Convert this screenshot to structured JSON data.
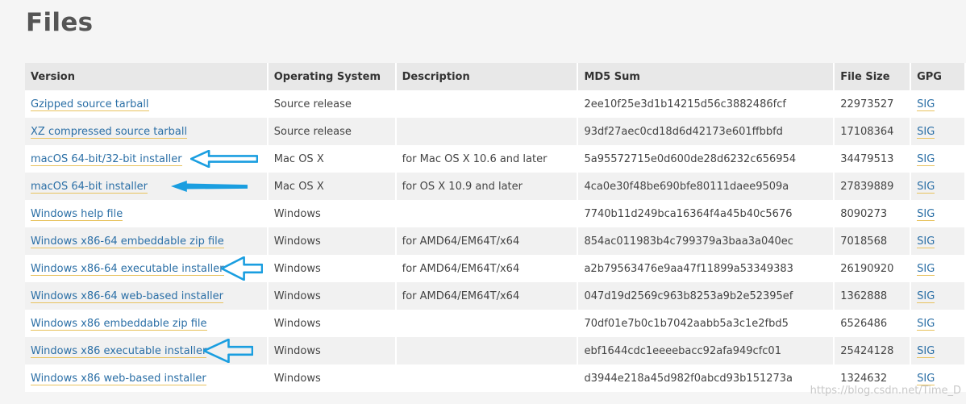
{
  "page": {
    "title": "Files",
    "watermark": "https://blog.csdn.net/Time_D"
  },
  "colors": {
    "link": "#2b6fa6",
    "link_underline": "#e8c25e",
    "arrow": "#1a9ee0"
  },
  "table": {
    "headers": {
      "version": "Version",
      "os": "Operating System",
      "description": "Description",
      "md5": "MD5 Sum",
      "size": "File Size",
      "gpg": "GPG"
    },
    "rows": [
      {
        "version": "Gzipped source tarball",
        "os": "Source release",
        "description": "",
        "md5": "2ee10f25e3d1b14215d56c3882486fcf",
        "size": "22973527",
        "gpg": "SIG"
      },
      {
        "version": "XZ compressed source tarball",
        "os": "Source release",
        "description": "",
        "md5": "93df27aec0cd18d6d42173e601ffbbfd",
        "size": "17108364",
        "gpg": "SIG"
      },
      {
        "version": "macOS 64-bit/32-bit installer",
        "os": "Mac OS X",
        "description": "for Mac OS X 10.6 and later",
        "md5": "5a95572715e0d600de28d6232c656954",
        "size": "34479513",
        "gpg": "SIG"
      },
      {
        "version": "macOS 64-bit installer",
        "os": "Mac OS X",
        "description": "for OS X 10.9 and later",
        "md5": "4ca0e30f48be690bfe80111daee9509a",
        "size": "27839889",
        "gpg": "SIG"
      },
      {
        "version": "Windows help file",
        "os": "Windows",
        "description": "",
        "md5": "7740b11d249bca16364f4a45b40c5676",
        "size": "8090273",
        "gpg": "SIG"
      },
      {
        "version": "Windows x86-64 embeddable zip file",
        "os": "Windows",
        "description": "for AMD64/EM64T/x64",
        "md5": "854ac011983b4c799379a3baa3a040ec",
        "size": "7018568",
        "gpg": "SIG"
      },
      {
        "version": "Windows x86-64 executable installer",
        "os": "Windows",
        "description": "for AMD64/EM64T/x64",
        "md5": "a2b79563476e9aa47f11899a53349383",
        "size": "26190920",
        "gpg": "SIG"
      },
      {
        "version": "Windows x86-64 web-based installer",
        "os": "Windows",
        "description": "for AMD64/EM64T/x64",
        "md5": "047d19d2569c963b8253a9b2e52395ef",
        "size": "1362888",
        "gpg": "SIG"
      },
      {
        "version": "Windows x86 embeddable zip file",
        "os": "Windows",
        "description": "",
        "md5": "70df01e7b0c1b7042aabb5a3c1e2fbd5",
        "size": "6526486",
        "gpg": "SIG"
      },
      {
        "version": "Windows x86 executable installer",
        "os": "Windows",
        "description": "",
        "md5": "ebf1644cdc1eeeebacc92afa949cfc01",
        "size": "25424128",
        "gpg": "SIG"
      },
      {
        "version": "Windows x86 web-based installer",
        "os": "Windows",
        "description": "",
        "md5": "d3944e218a45d982f0abcd93b151273a",
        "size": "1324632",
        "gpg": "SIG"
      }
    ]
  },
  "annotations": [
    {
      "row": 2,
      "icon": "hollow-arrow-left-icon"
    },
    {
      "row": 3,
      "icon": "solid-arrow-left-icon"
    },
    {
      "row": 6,
      "icon": "hollow-arrow-left-icon"
    },
    {
      "row": 9,
      "icon": "hollow-arrow-left-icon"
    }
  ]
}
